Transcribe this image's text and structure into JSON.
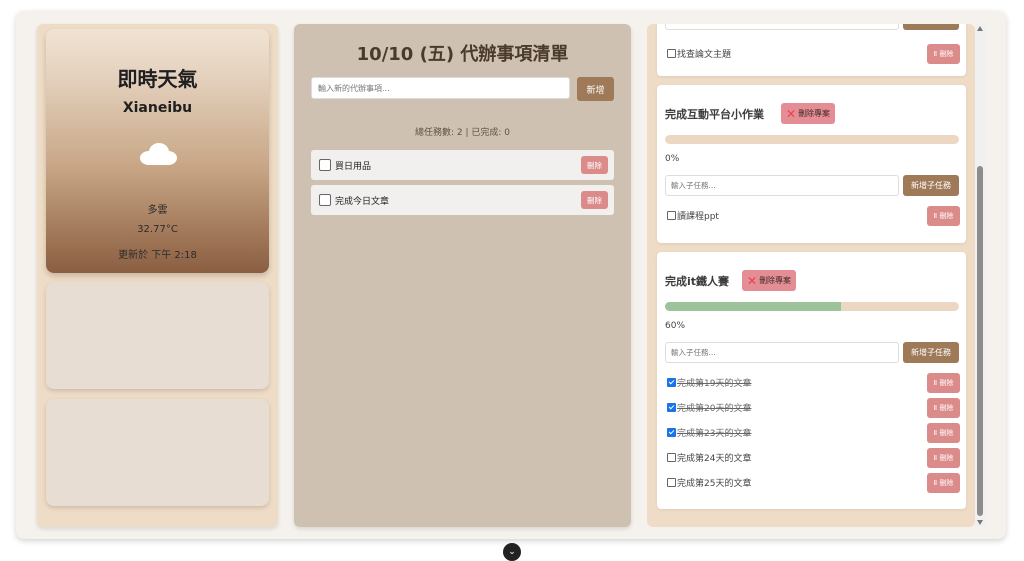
{
  "weather": {
    "title": "即時天氣",
    "city": "Xianeibu",
    "icon": "cloud-icon",
    "description": "多雲",
    "temperature": "32.77°C",
    "updated": "更新於 下午 2:18"
  },
  "todo": {
    "title": "10/10 (五) 代辦事項清單",
    "input_placeholder": "輸入新的代辦事項...",
    "add_label": "新增",
    "stats": "總任務數: 2 | 已完成: 0",
    "items": [
      {
        "label": "買日用品",
        "done": false,
        "delete_label": "刪除"
      },
      {
        "label": "完成今日文章",
        "done": false,
        "delete_label": "刪除"
      }
    ]
  },
  "projects": {
    "top_partial": {
      "subtask": {
        "label": "找查論文主題",
        "done": false,
        "delete_label": "刪除"
      }
    },
    "list": [
      {
        "title": "完成互動平台小作業",
        "delete_label": "刪除專案",
        "progress_percent": 0,
        "progress_label": "0%",
        "input_placeholder": "輸入子任務...",
        "add_label": "新增子任務",
        "subtasks": [
          {
            "label": "讀課程ppt",
            "done": false,
            "delete_label": "刪除"
          }
        ]
      },
      {
        "title": "完成it鐵人賽",
        "delete_label": "刪除專案",
        "progress_percent": 60,
        "progress_label": "60%",
        "input_placeholder": "輸入子任務...",
        "add_label": "新增子任務",
        "subtasks": [
          {
            "label": "完成第19天的文章",
            "done": true,
            "delete_label": "刪除"
          },
          {
            "label": "完成第20天的文章",
            "done": true,
            "delete_label": "刪除"
          },
          {
            "label": "完成第23天的文章",
            "done": true,
            "delete_label": "刪除"
          },
          {
            "label": "完成第24天的文章",
            "done": false,
            "delete_label": "刪除"
          },
          {
            "label": "完成第25天的文章",
            "done": false,
            "delete_label": "刪除"
          }
        ]
      }
    ]
  },
  "colors": {
    "accent": "#9f7a59",
    "delete": "#dc8b8b",
    "progress_fill": "#9dc39c",
    "progress_track": "#ecd8c2"
  }
}
